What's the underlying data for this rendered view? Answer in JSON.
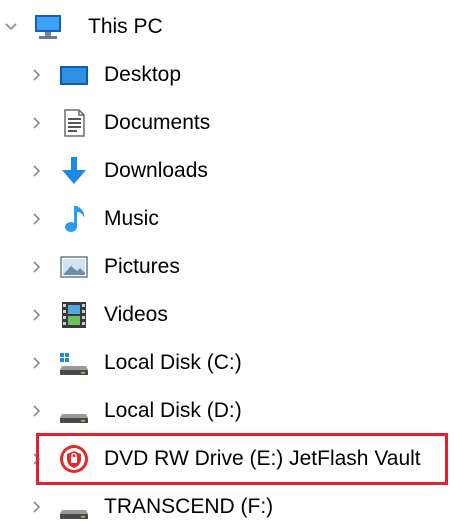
{
  "nav_tree": {
    "root": {
      "label": "This PC",
      "expanded": true,
      "icon": "computer-icon"
    },
    "items": [
      {
        "label": "Desktop",
        "icon": "desktop-icon"
      },
      {
        "label": "Documents",
        "icon": "documents-icon"
      },
      {
        "label": "Downloads",
        "icon": "downloads-icon"
      },
      {
        "label": "Music",
        "icon": "music-icon"
      },
      {
        "label": "Pictures",
        "icon": "pictures-icon"
      },
      {
        "label": "Videos",
        "icon": "videos-icon"
      },
      {
        "label": "Local Disk (C:)",
        "icon": "system-drive-icon"
      },
      {
        "label": "Local Disk (D:)",
        "icon": "drive-icon"
      },
      {
        "label": "DVD RW Drive (E:) JetFlash Vault",
        "icon": "jetflash-vault-icon",
        "highlighted": true
      },
      {
        "label": "TRANSCEND (F:)",
        "icon": "drive-icon"
      }
    ]
  },
  "colors": {
    "highlight_border": "#e5202e",
    "chevron": "#8a8a8a",
    "text": "#000000",
    "download_arrow": "#1e88e5",
    "music_note": "#2b9bf4"
  }
}
